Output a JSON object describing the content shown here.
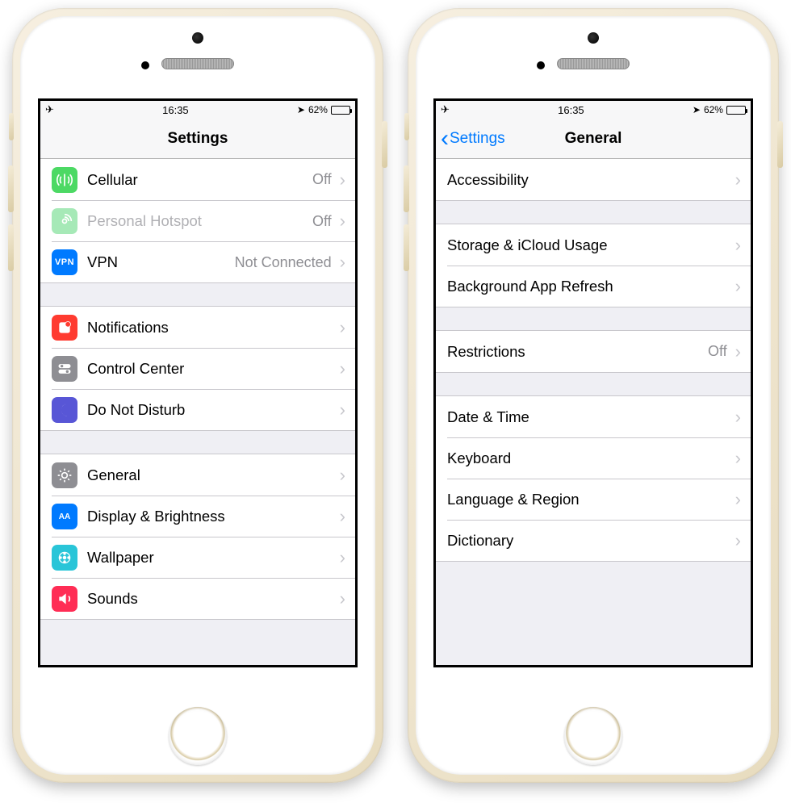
{
  "status": {
    "time": "16:35",
    "battery_pct": "62%"
  },
  "left": {
    "title": "Settings",
    "rows": {
      "cellular": {
        "label": "Cellular",
        "value": "Off"
      },
      "hotspot": {
        "label": "Personal Hotspot",
        "value": "Off"
      },
      "vpn": {
        "label": "VPN",
        "badge": "VPN",
        "value": "Not Connected"
      },
      "notif": {
        "label": "Notifications"
      },
      "control": {
        "label": "Control Center"
      },
      "dnd": {
        "label": "Do Not Disturb"
      },
      "general": {
        "label": "General"
      },
      "display": {
        "label": "Display & Brightness",
        "badge": "AA"
      },
      "wallpaper": {
        "label": "Wallpaper"
      },
      "sounds": {
        "label": "Sounds"
      }
    }
  },
  "right": {
    "back": "Settings",
    "title": "General",
    "rows": {
      "accessibility": {
        "label": "Accessibility"
      },
      "storage": {
        "label": "Storage & iCloud Usage"
      },
      "bg_refresh": {
        "label": "Background App Refresh"
      },
      "restrictions": {
        "label": "Restrictions",
        "value": "Off"
      },
      "datetime": {
        "label": "Date & Time"
      },
      "keyboard": {
        "label": "Keyboard"
      },
      "langregion": {
        "label": "Language & Region"
      },
      "dictionary": {
        "label": "Dictionary"
      }
    }
  }
}
